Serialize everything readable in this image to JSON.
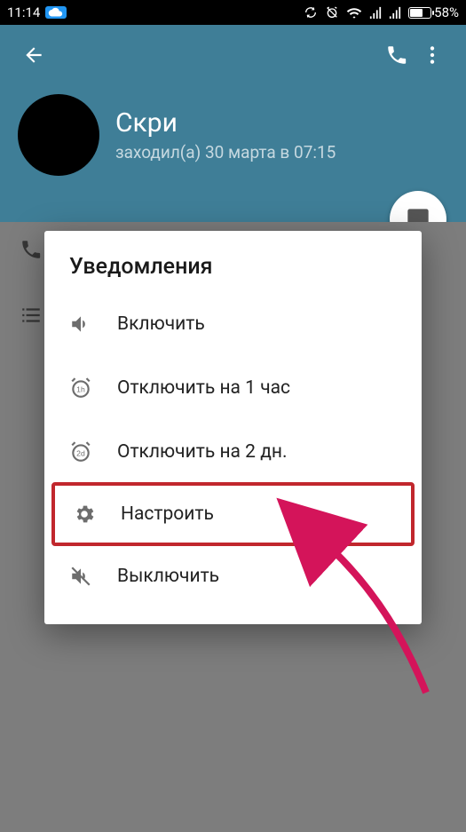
{
  "statusbar": {
    "time": "11:14",
    "battery_pct": "58%"
  },
  "header": {
    "name": "Скри",
    "last_seen": "заходил(а) 30 марта в 07:15"
  },
  "dialog": {
    "title": "Уведомления",
    "options": [
      {
        "label": "Включить"
      },
      {
        "label": "Отключить на 1 час"
      },
      {
        "label": "Отключить на 2 дн."
      },
      {
        "label": "Настроить"
      },
      {
        "label": "Выключить"
      }
    ]
  }
}
